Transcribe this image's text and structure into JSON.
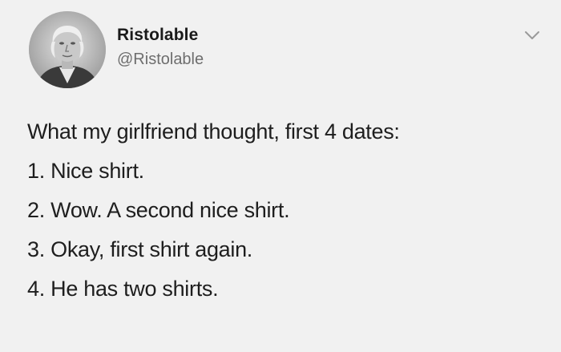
{
  "tweet": {
    "author": {
      "display_name": "Ristolable",
      "handle": "@Ristolable",
      "avatar_icon": "portrait-avatar"
    },
    "menu_icon": "chevron-down-icon",
    "lines": [
      "What my girlfriend thought, first 4 dates:",
      "1. Nice shirt.",
      "2. Wow. A second nice shirt.",
      "3. Okay, first shirt again.",
      "4. He has two shirts."
    ]
  },
  "colors": {
    "background": "#f1f1f1",
    "text": "#1e1e1e",
    "handle": "#6e6e6e",
    "chevron": "#9a9a9a"
  }
}
